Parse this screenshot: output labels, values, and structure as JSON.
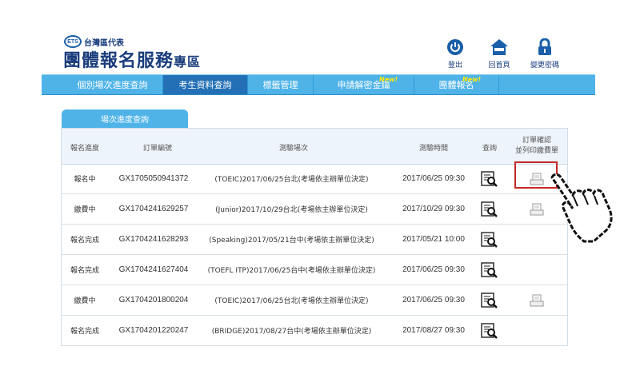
{
  "header": {
    "ets_badge": "ETS",
    "subtitle": "台灣區代表",
    "title_main": "團體報名服務",
    "title_suffix": "專區"
  },
  "top_links": [
    {
      "label": "登出",
      "icon": "power-icon"
    },
    {
      "label": "回首頁",
      "icon": "home-icon"
    },
    {
      "label": "變更密碼",
      "icon": "lock-icon"
    }
  ],
  "nav": {
    "items": [
      {
        "label": "個別場次進度查詢",
        "active": false
      },
      {
        "label": "考生資料查詢",
        "active": true
      },
      {
        "label": "標籤管理",
        "active": false
      },
      {
        "label": "申請解密金鑰",
        "active": false,
        "badge": "New!"
      },
      {
        "label": "團體報名",
        "active": false,
        "badge": "New!"
      }
    ]
  },
  "tab": {
    "label": "場次進度查詢"
  },
  "table": {
    "headers": {
      "status": "報名進度",
      "order": "訂單編號",
      "session": "測驗場次",
      "time": "測驗時間",
      "query": "查詢",
      "confirm_line1": "訂單確認",
      "confirm_line2": "並列印繳費單"
    },
    "rows": [
      {
        "status": "報名中",
        "order": "GX1705050941372",
        "session": "(TOEIC)2017/06/25台北(考場依主辦單位決定)",
        "time": "2017/06/25 09:30",
        "print": true
      },
      {
        "status": "繳費中",
        "order": "GX1704241629257",
        "session": "(Junior)2017/10/29台北(考場依主辦單位決定)",
        "time": "2017/10/29 09:30",
        "print": true
      },
      {
        "status": "報名完成",
        "order": "GX1704241628293",
        "session": "(Speaking)2017/05/21台中(考場依主辦單位決定)",
        "time": "2017/05/21 10:00",
        "print": false
      },
      {
        "status": "報名完成",
        "order": "GX1704241627404",
        "session": "(TOEFL ITP)2017/06/25台中(考場依主辦單位決定)",
        "time": "2017/06/25 09:30",
        "print": false
      },
      {
        "status": "繳費中",
        "order": "GX1704201800204",
        "session": "(TOEIC)2017/06/25台北(考場依主辦單位決定)",
        "time": "2017/06/25 09:30",
        "print": true
      },
      {
        "status": "報名完成",
        "order": "GX1704201220247",
        "session": "(BRIDGE)2017/08/27台中(考場依主辦單位決定)",
        "time": "2017/08/27 09:30",
        "print": false
      }
    ]
  },
  "colors": {
    "nav": "#4fb3e8",
    "nav_active": "#2470b6",
    "brand": "#1a3d7c",
    "highlight": "#c62828"
  }
}
